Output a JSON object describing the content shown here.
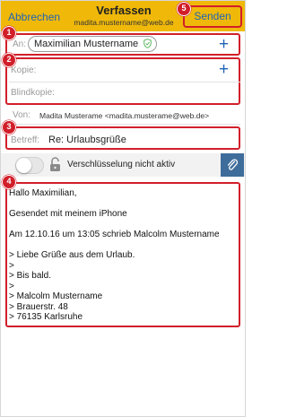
{
  "header": {
    "cancel_label": "Abbrechen",
    "title": "Verfassen",
    "account": "madita.mustername@web.de",
    "send_label": "Senden"
  },
  "badges": [
    "1",
    "2",
    "3",
    "4",
    "5"
  ],
  "to": {
    "label": "An:",
    "recipient": "Maximilian Mustername"
  },
  "cc": {
    "label": "Kopie:"
  },
  "bcc": {
    "label": "Blindkopie:"
  },
  "from": {
    "label": "Von:",
    "value": "Madita Musterame <madita.musterame@web.de>"
  },
  "subject": {
    "label": "Betreff:",
    "value": "Re: Urlaubsgrüße"
  },
  "encryption": {
    "enabled": false,
    "label": "Verschlüsselung nicht aktiv"
  },
  "body": {
    "lines": [
      "Hallo Maximilian,",
      "",
      "Gesendet mit meinem iPhone",
      "",
      "Am 12.10.16 um 13:05 schrieb Malcolm Mustername",
      "",
      "> Liebe Grüße aus dem Urlaub.",
      ">",
      "> Bis bald.",
      ">",
      "> Malcolm Mustername",
      "> Brauerstr. 48",
      "> 76135 Karlsruhe"
    ]
  },
  "colors": {
    "header_bg": "#f0b90a",
    "link_blue": "#1f64b4",
    "highlight_red": "#d11f2a"
  }
}
